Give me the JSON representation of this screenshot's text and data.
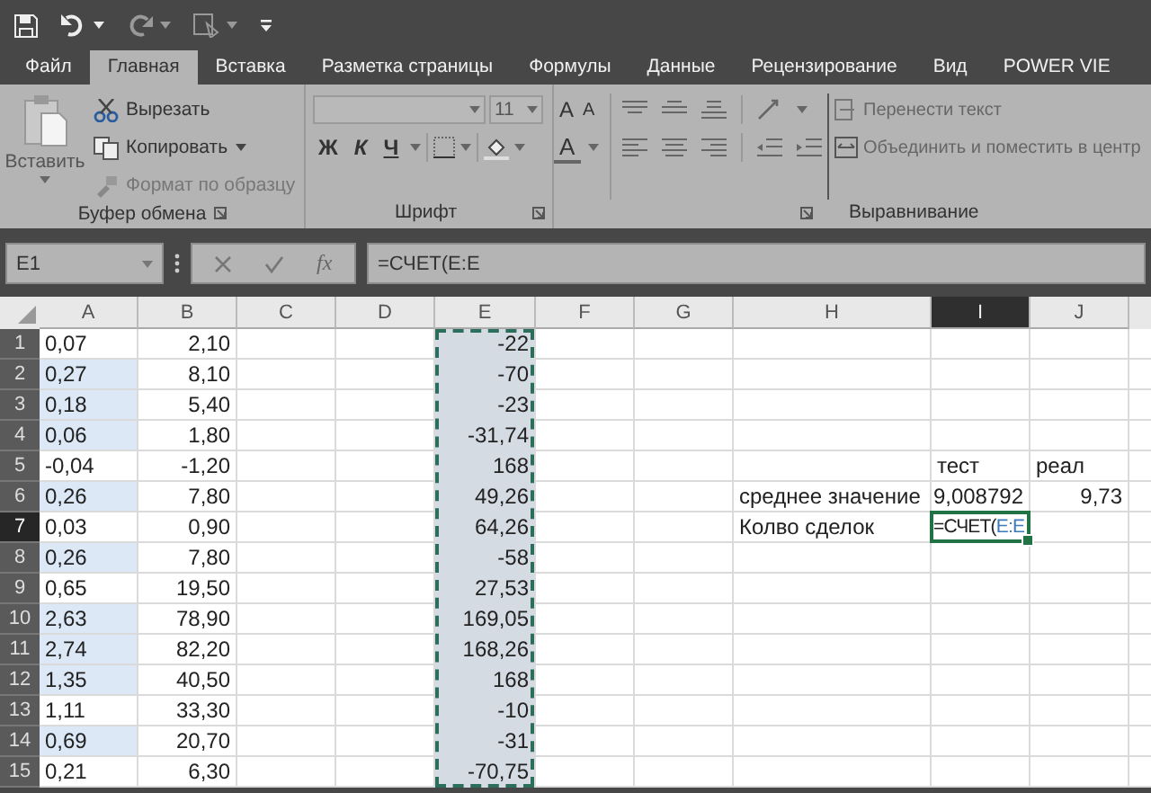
{
  "tabs": [
    {
      "label": "Файл",
      "selected": false
    },
    {
      "label": "Главная",
      "selected": true
    },
    {
      "label": "Вставка",
      "selected": false
    },
    {
      "label": "Разметка страницы",
      "selected": false
    },
    {
      "label": "Формулы",
      "selected": false
    },
    {
      "label": "Данные",
      "selected": false
    },
    {
      "label": "Рецензирование",
      "selected": false
    },
    {
      "label": "Вид",
      "selected": false
    },
    {
      "label": "POWER VIE",
      "selected": false
    }
  ],
  "ribbon": {
    "clipboard": {
      "title": "Буфер обмена",
      "paste": "Вставить",
      "cut": "Вырезать",
      "copy": "Копировать",
      "format_painter": {
        "label": "Формат по образцу",
        "disabled": true
      }
    },
    "font": {
      "title": "Шрифт",
      "font_size": "11",
      "grow": "A",
      "shrink": "A",
      "bold": "Ж",
      "italic": "К",
      "underline": "Ч",
      "font_color": "A"
    },
    "alignment": {
      "title": "Выравнивание",
      "wrap_text": "Перенести текст",
      "merge_center": "Объединить и поместить в центр"
    }
  },
  "formula_bar": {
    "name_box": "E1",
    "function_button": "fx",
    "formula": "=СЧЕТ(E:E"
  },
  "columns": [
    {
      "label": "A",
      "selected": false,
      "marquee": false
    },
    {
      "label": "B",
      "selected": false,
      "marquee": false
    },
    {
      "label": "C",
      "selected": false,
      "marquee": false
    },
    {
      "label": "D",
      "selected": false,
      "marquee": false
    },
    {
      "label": "E",
      "selected": false,
      "marquee": true
    },
    {
      "label": "F",
      "selected": false,
      "marquee": false
    },
    {
      "label": "G",
      "selected": false,
      "marquee": false
    },
    {
      "label": "H",
      "selected": false,
      "marquee": false
    },
    {
      "label": "I",
      "selected": true,
      "marquee": false
    },
    {
      "label": "J",
      "selected": false,
      "marquee": false
    }
  ],
  "rows": [
    {
      "number": "1",
      "selected": false,
      "shaded": false,
      "cells": {
        "A": "0,07",
        "B": "2,10",
        "E": "-22"
      }
    },
    {
      "number": "2",
      "selected": false,
      "shaded": true,
      "cells": {
        "A": "0,27",
        "B": "8,10",
        "E": "-70"
      }
    },
    {
      "number": "3",
      "selected": false,
      "shaded": true,
      "cells": {
        "A": "0,18",
        "B": "5,40",
        "E": "-23"
      }
    },
    {
      "number": "4",
      "selected": false,
      "shaded": true,
      "cells": {
        "A": "0,06",
        "B": "1,80",
        "E": "-31,74"
      }
    },
    {
      "number": "5",
      "selected": false,
      "shaded": false,
      "cells": {
        "A": "-0,04",
        "B": "-1,20",
        "E": "168",
        "I": "тест",
        "J": "реал"
      }
    },
    {
      "number": "6",
      "selected": false,
      "shaded": true,
      "cells": {
        "A": "0,26",
        "B": "7,80",
        "E": "49,26",
        "H": "среднее значение",
        "I": "9,008792",
        "J": "9,73"
      }
    },
    {
      "number": "7",
      "selected": true,
      "shaded": false,
      "cells": {
        "A": "0,03",
        "B": "0,90",
        "E": "64,26",
        "H": "Колво сделок"
      },
      "editing": {
        "formula": "=СЧЕТ(",
        "reference": "E:E"
      }
    },
    {
      "number": "8",
      "selected": false,
      "shaded": true,
      "cells": {
        "A": "0,26",
        "B": "7,80",
        "E": "-58"
      }
    },
    {
      "number": "9",
      "selected": false,
      "shaded": false,
      "cells": {
        "A": "0,65",
        "B": "19,50",
        "E": "27,53"
      }
    },
    {
      "number": "10",
      "selected": false,
      "shaded": true,
      "cells": {
        "A": "2,63",
        "B": "78,90",
        "E": "169,05"
      }
    },
    {
      "number": "11",
      "selected": false,
      "shaded": true,
      "cells": {
        "A": "2,74",
        "B": "82,20",
        "E": "168,26"
      }
    },
    {
      "number": "12",
      "selected": false,
      "shaded": true,
      "cells": {
        "A": "1,35",
        "B": "40,50",
        "E": "168"
      }
    },
    {
      "number": "13",
      "selected": false,
      "shaded": false,
      "cells": {
        "A": "1,11",
        "B": "33,30",
        "E": "-10"
      }
    },
    {
      "number": "14",
      "selected": false,
      "shaded": true,
      "cells": {
        "A": "0,69",
        "B": "20,70",
        "E": "-31"
      }
    },
    {
      "number": "15",
      "selected": false,
      "shaded": false,
      "cells": {
        "A": "0,21",
        "B": "6,30",
        "E": "-70,75"
      }
    }
  ]
}
